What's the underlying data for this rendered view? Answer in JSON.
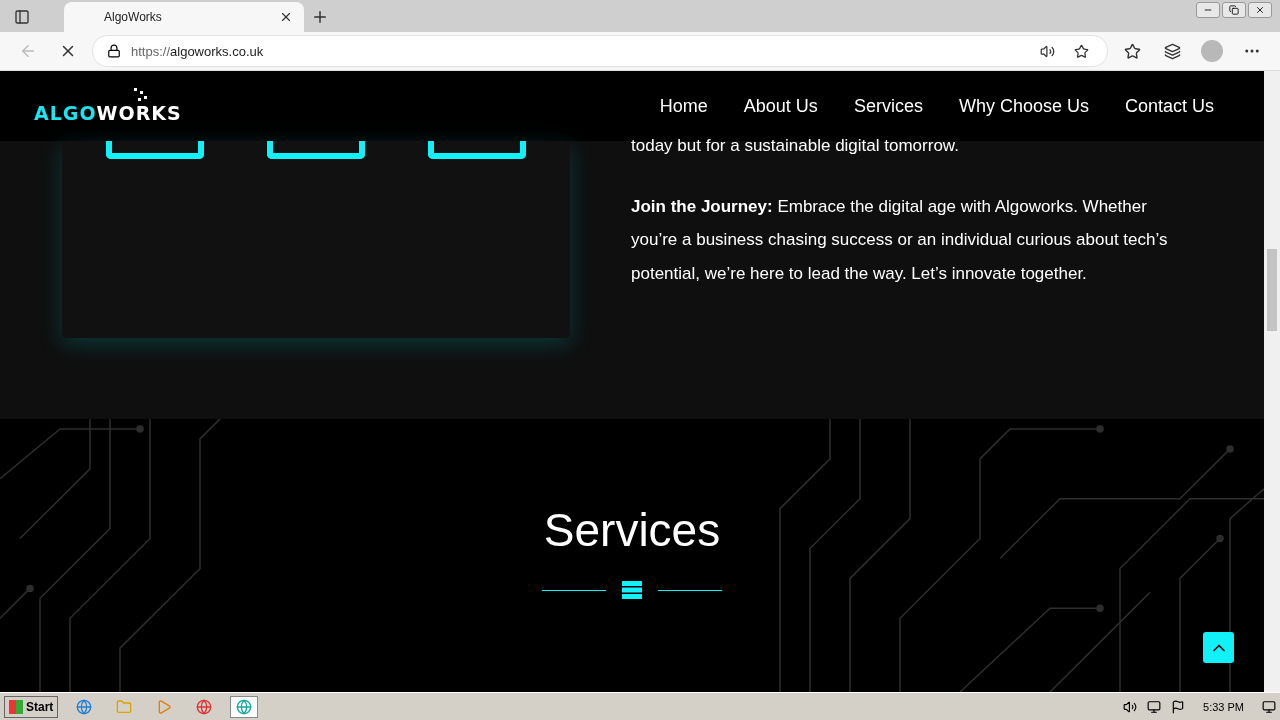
{
  "browser": {
    "tab_title": "AlgoWorks",
    "url_prefix": "https://",
    "url_host": "algoworks.co.uk"
  },
  "site": {
    "logo": {
      "accent": "ALGO",
      "rest": "WORKS"
    },
    "nav": [
      {
        "label": "Home"
      },
      {
        "label": "About Us"
      },
      {
        "label": "Services"
      },
      {
        "label": "Why Choose Us"
      },
      {
        "label": "Contact Us"
      }
    ],
    "about": {
      "paragraphs": [
        "today but for a sustainable digital tomorrow.",
        "**Join the Journey:** Embrace the digital age with Algoworks. Whether you’re a business chasing success or an individual curious about tech’s potential, we’re here to lead the way. Let’s innovate together."
      ]
    },
    "services": {
      "title": "Services"
    }
  },
  "taskbar": {
    "start": "Start",
    "time": "5:33 PM"
  }
}
